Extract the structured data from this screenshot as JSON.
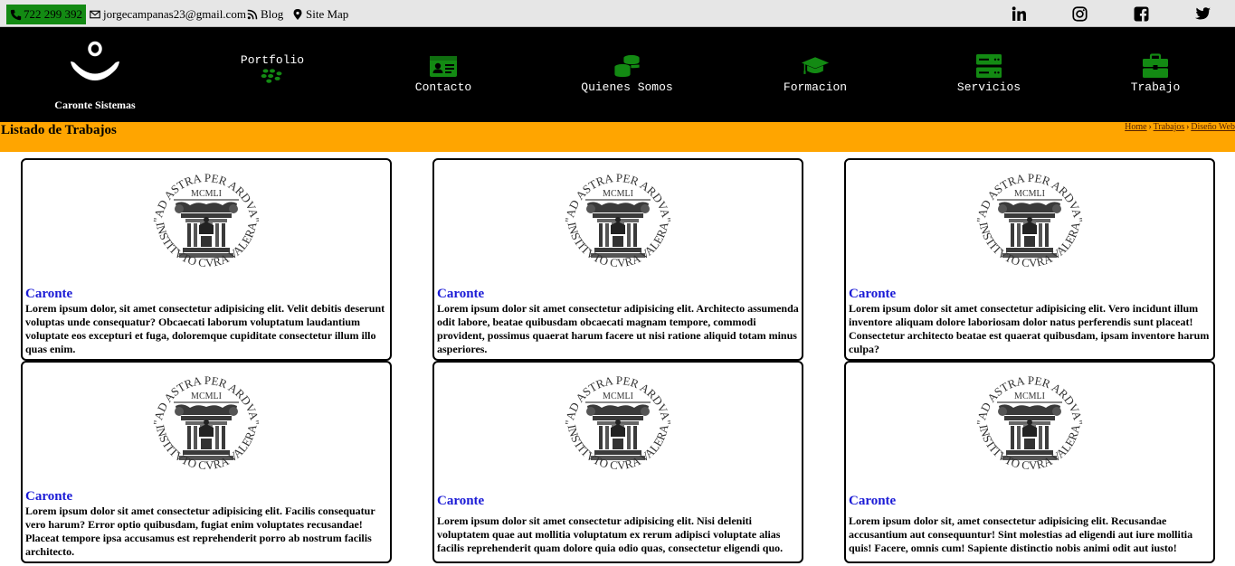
{
  "topbar": {
    "phone": "722 299 392",
    "email": "jorgecampanas23@gmail.com",
    "blog": "Blog",
    "sitemap": "Site Map",
    "social": [
      "linkedin-icon",
      "instagram-icon",
      "facebook-icon",
      "twitter-icon"
    ]
  },
  "header": {
    "logo_text": "Caronte Sistemas",
    "nav": [
      {
        "label": "Portfolio",
        "icon": "blackberry-icon"
      },
      {
        "label": "Contacto",
        "icon": "id-card-icon"
      },
      {
        "label": "Quienes Somos",
        "icon": "coins-icon"
      },
      {
        "label": "Formacion",
        "icon": "graduation-cap-icon"
      },
      {
        "label": "Servicios",
        "icon": "server-icon"
      },
      {
        "label": "Trabajo",
        "icon": "briefcase-icon"
      }
    ]
  },
  "titlebar": {
    "title": "Listado de Trabajos",
    "breadcrumb": [
      "Home",
      "Trabajos",
      "Diseño Web"
    ]
  },
  "cards": [
    {
      "title": "Caronte",
      "text": "Lorem ipsum dolor, sit amet consectetur adipisicing elit. Velit debitis deserunt voluptas unde consequatur? Obcaecati laborum voluptatum laudantium voluptate eos excepturi et fuga, doloremque cupiditate consectetur illum illo quas enim."
    },
    {
      "title": "Caronte",
      "text": "Lorem ipsum dolor sit amet consectetur adipisicing elit. Architecto assumenda odit labore, beatae quibusdam obcaecati magnam tempore, commodi provident, possimus quaerat harum facere ut nisi ratione aliquid totam minus asperiores."
    },
    {
      "title": "Caronte",
      "text": "Lorem ipsum dolor sit amet consectetur adipisicing elit. Vero incidunt illum inventore aliquam dolore laboriosam dolor natus perferendis sunt placeat! Consectetur architecto beatae est quaerat quibusdam, ipsam inventore harum culpa?"
    },
    {
      "title": "Caronte",
      "text": "Lorem ipsum dolor sit amet consectetur adipisicing elit. Facilis consequatur vero harum? Error optio quibusdam, fugiat enim voluptates recusandae! Placeat tempore ipsa accusamus est reprehenderit porro ab nostrum facilis architecto."
    },
    {
      "title": "Caronte",
      "text": "Lorem ipsum dolor sit amet consectetur adipisicing elit. Nisi deleniti voluptatem quae aut mollitia voluptatum ex rerum adipisci voluptate alias facilis reprehenderit quam dolore quia odio quas, consectetur eligendi quo."
    },
    {
      "title": "Caronte",
      "text": "Lorem ipsum dolor sit, amet consectetur adipisicing elit. Recusandae accusantium aut consequuntur! Sint molestias ad eligendi aut iure mollitia quis! Facere, omnis cum! Sapiente distinctio nobis animi odit aut iusto!"
    }
  ],
  "seal": {
    "top_text": "\"AD ASTRA PER ARDVA\"",
    "middle_text": "MCMLI",
    "bottom_text": "INSTITVTO CVRA VALERA"
  },
  "colors": {
    "accent_green": "#138a13",
    "title_bar": "#ffa500",
    "header_bg": "#000000",
    "card_title": "#1a1ad6"
  }
}
